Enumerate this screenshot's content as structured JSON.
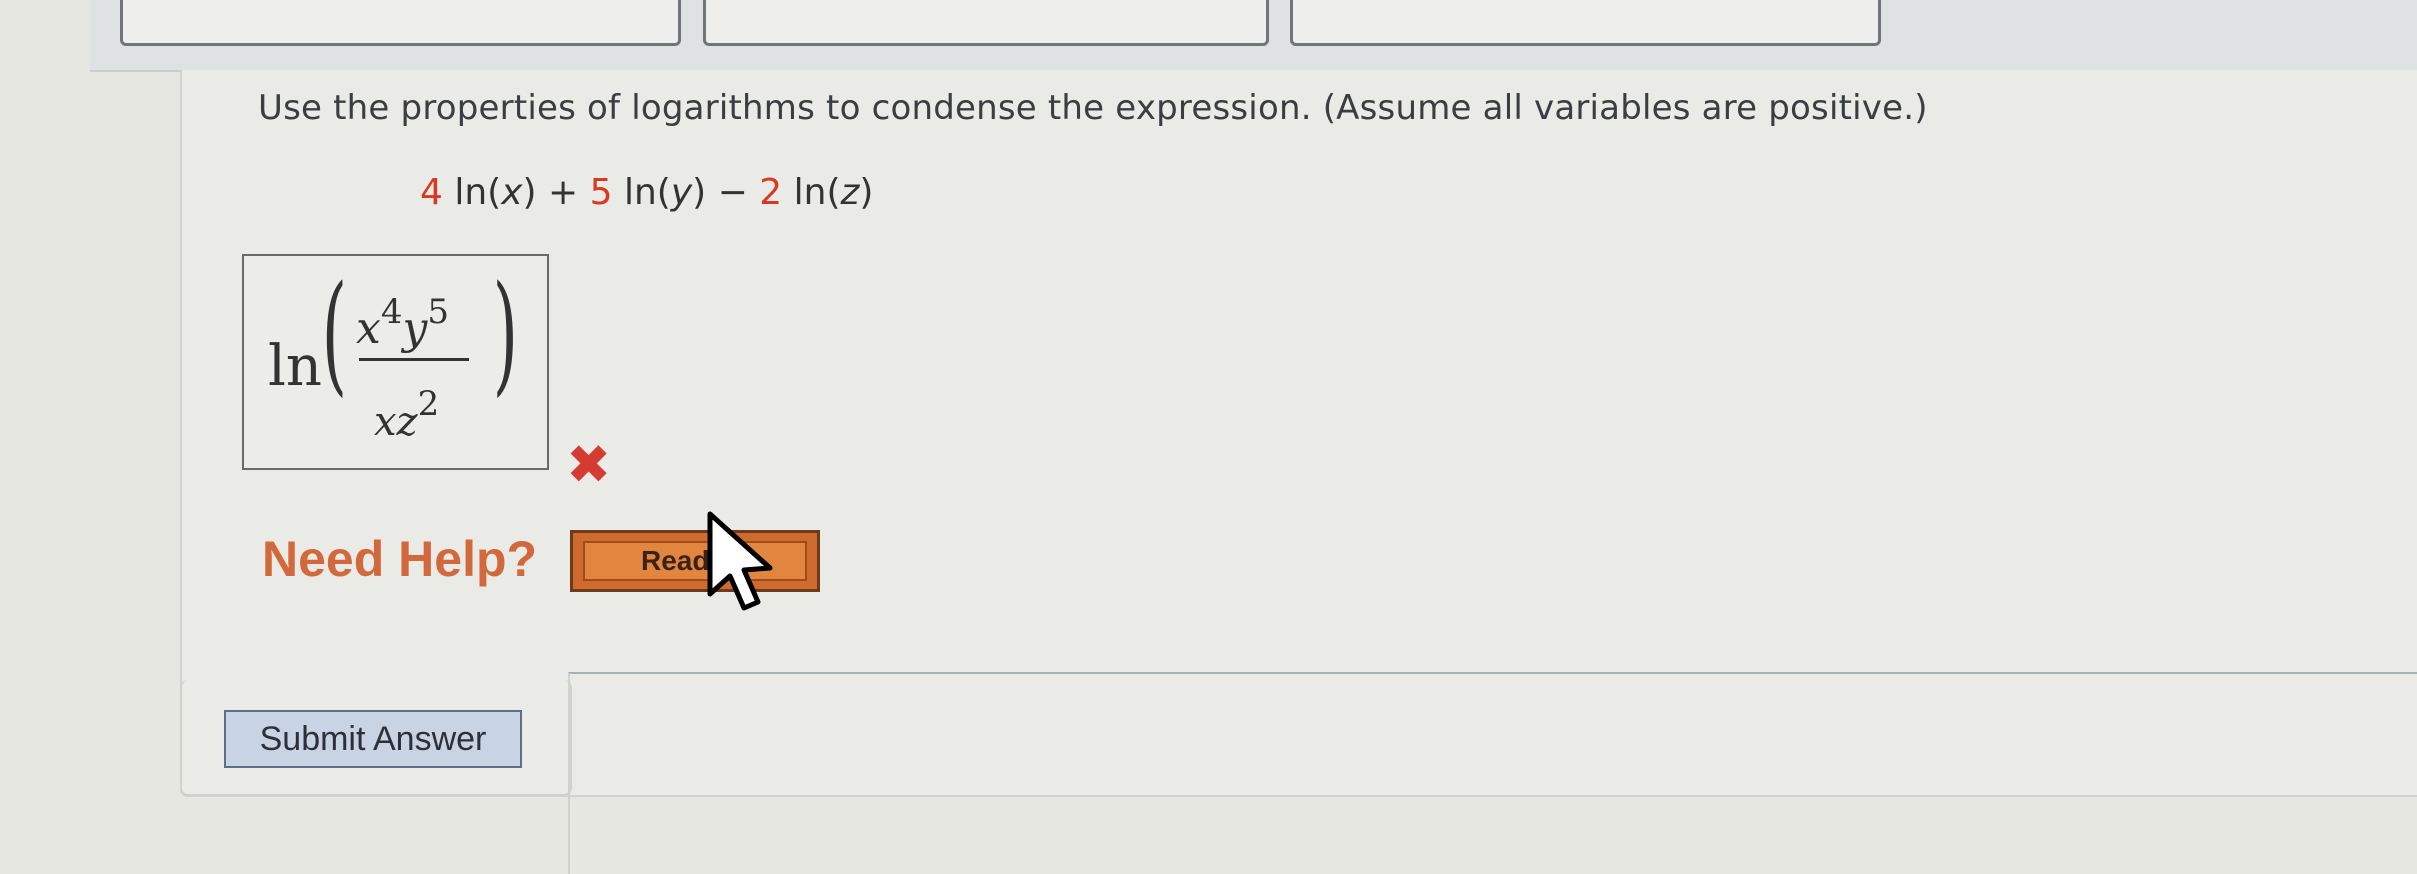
{
  "question": {
    "prompt": "Use the properties of logarithms to condense the expression. (Assume all variables are positive.)",
    "expression": {
      "c1": "4",
      "t1": " ln(",
      "v1": "x",
      "t1e": ") + ",
      "c2": "5",
      "t2": " ln(",
      "v2": "y",
      "t2e": ") − ",
      "c3": "2",
      "t3": " ln(",
      "v3": "z",
      "t3e": ")"
    }
  },
  "answer": {
    "ln": "ln",
    "numerator_x": "x",
    "numerator_x_exp": "4",
    "numerator_y": "y",
    "numerator_y_exp": "5",
    "denominator_xz": "xz",
    "denominator_exp": "2",
    "status": "incorrect"
  },
  "help": {
    "label": "Need Help?",
    "read_button": "Read"
  },
  "submit": {
    "label": "Submit Answer"
  },
  "colors": {
    "accent_orange": "#d2693c",
    "error_red": "#d63b32",
    "coefficient_red": "#d63b22"
  }
}
